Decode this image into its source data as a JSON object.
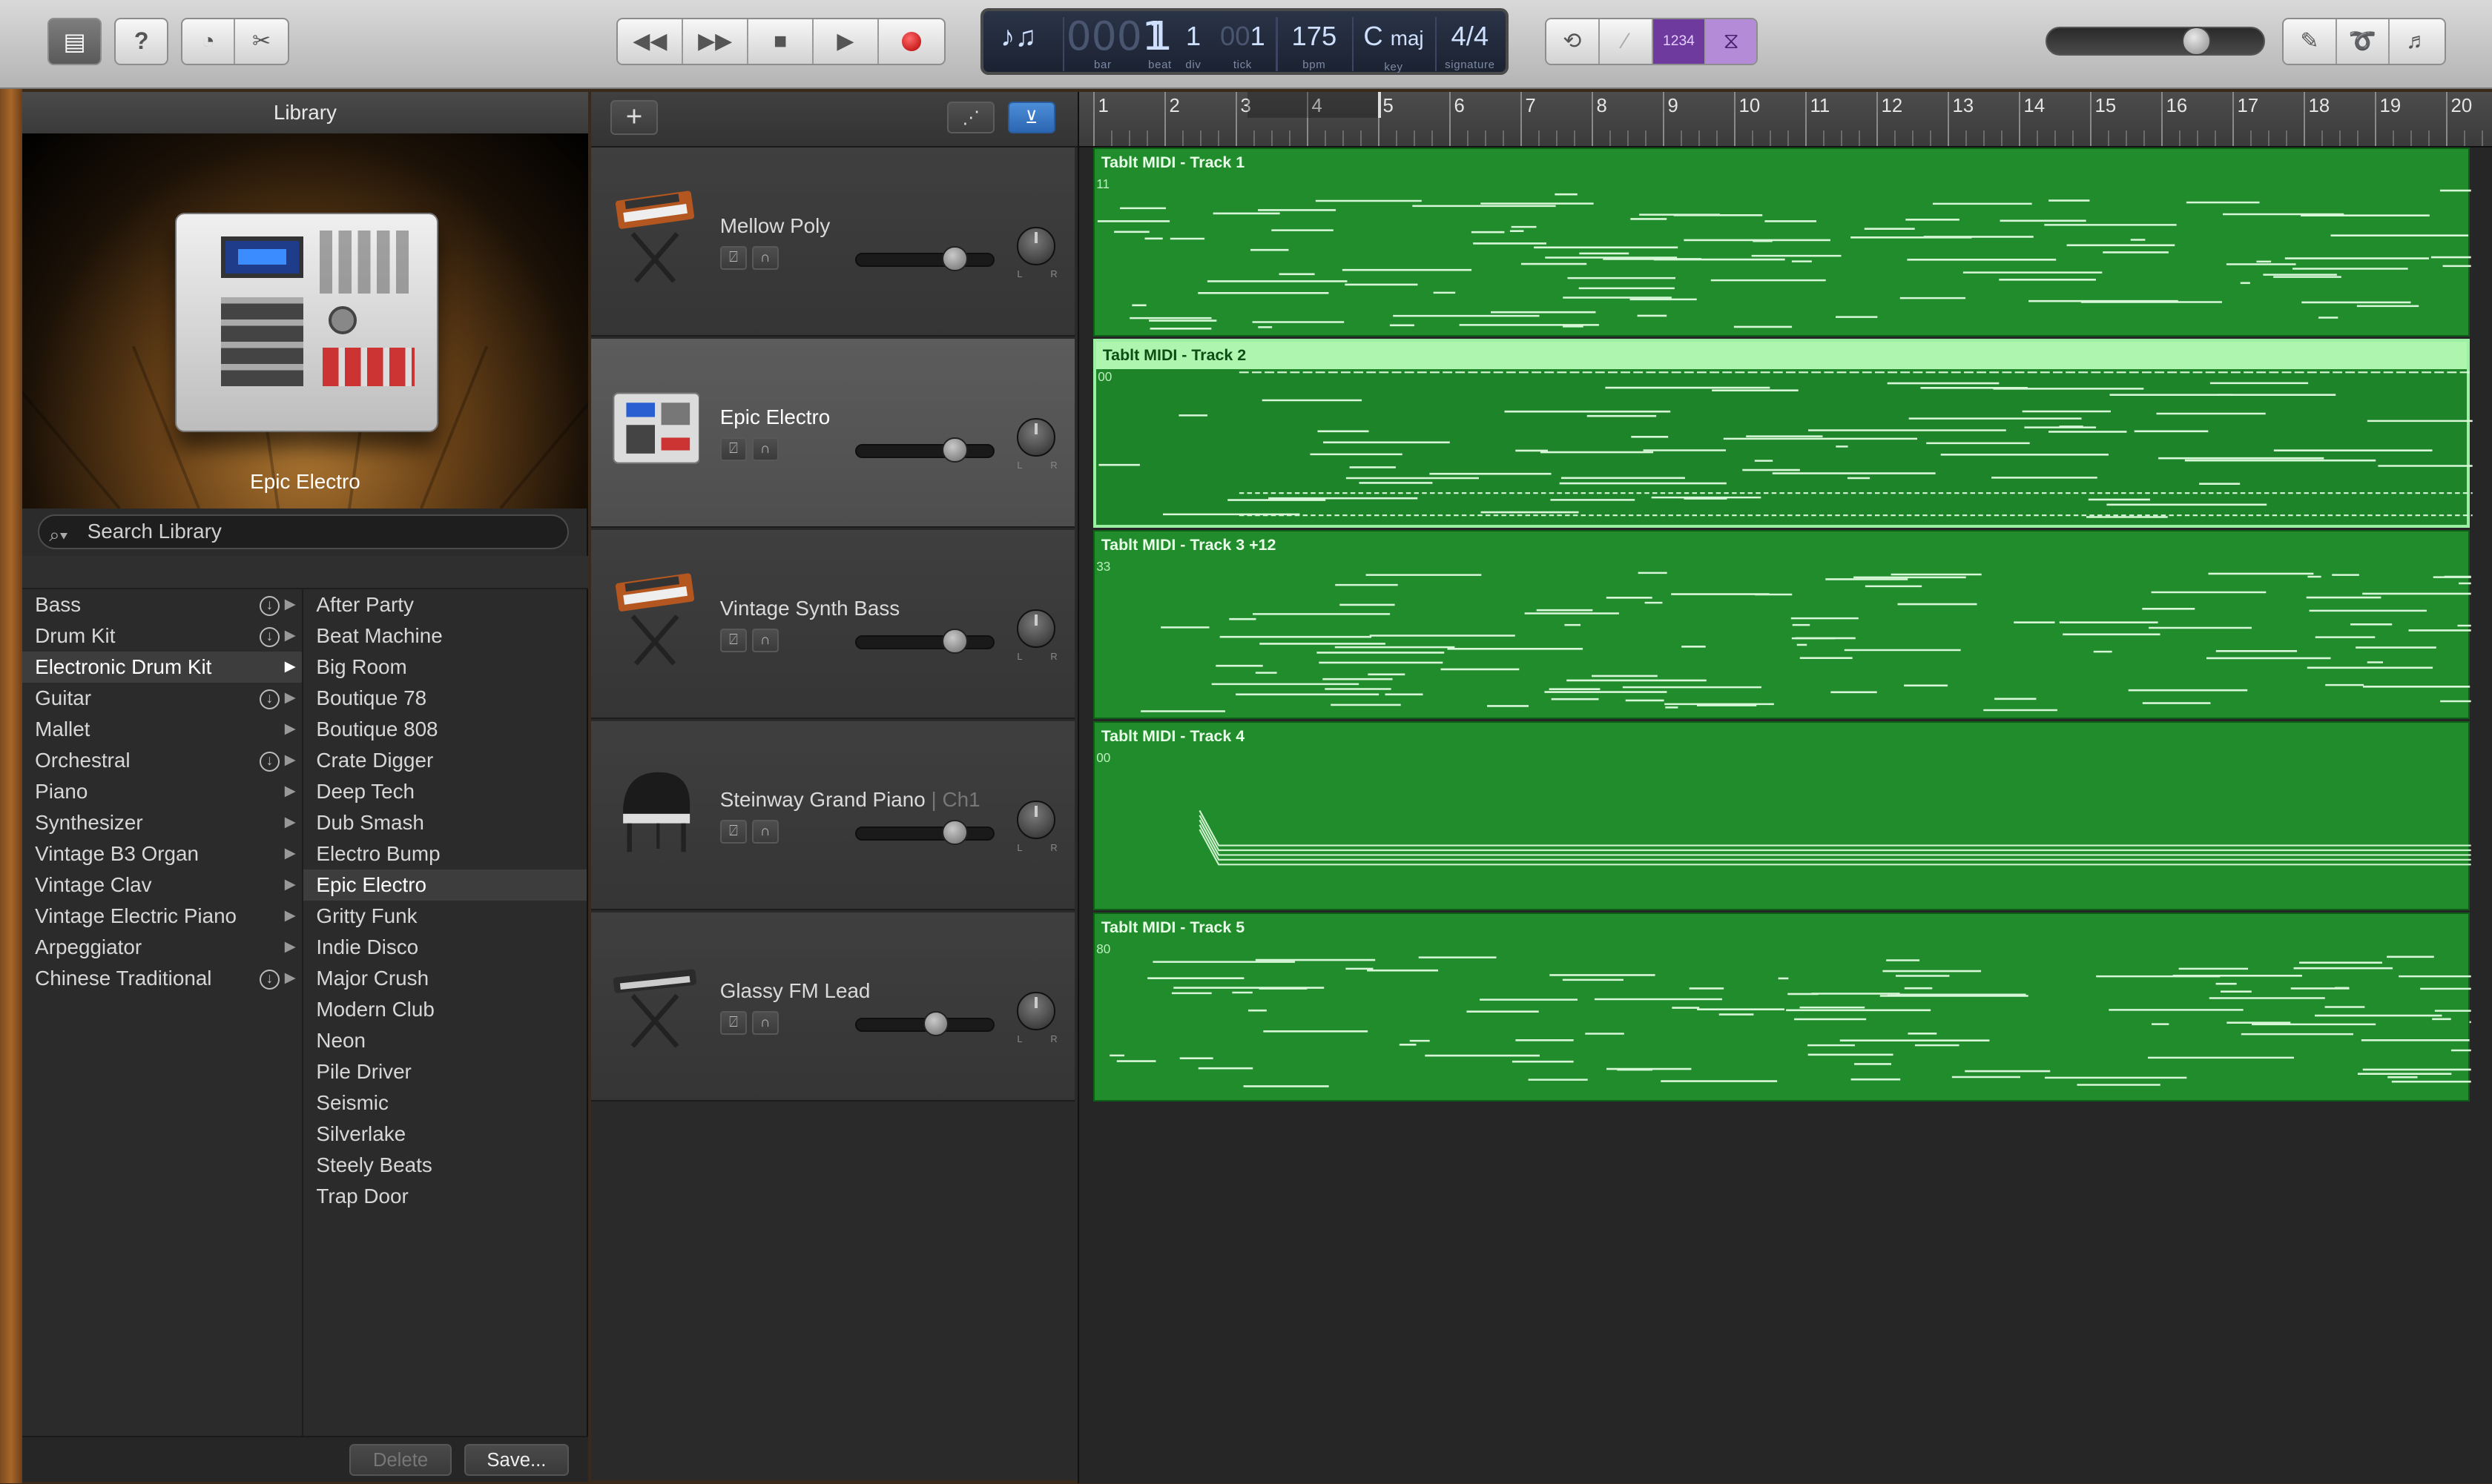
{
  "toolbar": {
    "left_icons": [
      "library-icon",
      "help-icon",
      "smart-controls-icon",
      "editors-icon"
    ],
    "transport": [
      "rewind-icon",
      "fast-forward-icon",
      "stop-icon",
      "play-icon",
      "record-icon"
    ],
    "lcd": {
      "bar": "1",
      "beat": "1",
      "div": "1",
      "tick": "1",
      "bar_prefix": "000",
      "tempo": "175",
      "key": "C",
      "key_mode": "maj",
      "signature": "4/4",
      "labels": {
        "bar": "bar",
        "beat": "beat",
        "div": "div",
        "tick": "tick",
        "bpm": "bpm",
        "key": "key",
        "signature": "signature"
      }
    },
    "count_in_label": "1234",
    "right_icons": [
      "cycle-icon",
      "tuner-icon",
      "count-in-icon",
      "metronome-icon",
      "notepad-icon",
      "loop-browser-icon",
      "media-browser-icon"
    ],
    "master_volume": 0.62,
    "colors": {
      "count_in": "#6e3a9e",
      "metronome": "#b48bd6"
    }
  },
  "library": {
    "title": "Library",
    "preview_label": "Epic Electro",
    "search_placeholder": "Search Library",
    "categories": [
      {
        "label": "Bass",
        "download": true
      },
      {
        "label": "Drum Kit",
        "download": true
      },
      {
        "label": "Electronic Drum Kit",
        "download": false,
        "selected": true
      },
      {
        "label": "Guitar",
        "download": true
      },
      {
        "label": "Mallet",
        "download": false
      },
      {
        "label": "Orchestral",
        "download": true
      },
      {
        "label": "Piano",
        "download": false
      },
      {
        "label": "Synthesizer",
        "download": false
      },
      {
        "label": "Vintage B3 Organ",
        "download": false
      },
      {
        "label": "Vintage Clav",
        "download": false
      },
      {
        "label": "Vintage Electric Piano",
        "download": false
      },
      {
        "label": "Arpeggiator",
        "download": false
      },
      {
        "label": "Chinese Traditional",
        "download": true
      }
    ],
    "patches": [
      "After Party",
      "Beat Machine",
      "Big Room",
      "Boutique 78",
      "Boutique 808",
      "Crate Digger",
      "Deep Tech",
      "Dub Smash",
      "Electro Bump",
      "Epic Electro",
      "Gritty Funk",
      "Indie Disco",
      "Major Crush",
      "Modern Club",
      "Neon",
      "Pile Driver",
      "Seismic",
      "Silverlake",
      "Steely Beats",
      "Trap Door"
    ],
    "selected_patch": "Epic Electro",
    "delete_label": "Delete",
    "save_label": "Save..."
  },
  "tracks_toolbar": {
    "add_label": "+"
  },
  "tracks": [
    {
      "name": "Mellow Poly",
      "sub": "",
      "icon": "synth-keyboard-icon",
      "volume": 0.72,
      "selected": false
    },
    {
      "name": "Epic Electro",
      "sub": "",
      "icon": "drum-machine-icon",
      "volume": 0.72,
      "selected": true
    },
    {
      "name": "Vintage Synth Bass",
      "sub": "",
      "icon": "synth-keyboard-icon",
      "volume": 0.72,
      "selected": false
    },
    {
      "name": "Steinway Grand Piano",
      "sub": "| Ch1",
      "icon": "grand-piano-icon",
      "volume": 0.72,
      "selected": false
    },
    {
      "name": "Glassy FM Lead",
      "sub": "",
      "icon": "keyboard-stand-icon",
      "volume": 0.58,
      "selected": false
    }
  ],
  "ruler": {
    "bars": [
      "1",
      "2",
      "3",
      "4",
      "5",
      "6",
      "7",
      "8",
      "9",
      "10",
      "11",
      "12",
      "13",
      "14",
      "15",
      "16",
      "17",
      "18",
      "19",
      "20"
    ]
  },
  "regions": [
    {
      "title": "Tablt MIDI - Track 1",
      "num": "11",
      "selected": false
    },
    {
      "title": "Tablt MIDI - Track 2",
      "num": "00",
      "selected": true
    },
    {
      "title": "Tablt MIDI - Track 3   +12",
      "num": "33",
      "selected": false
    },
    {
      "title": "Tablt MIDI - Track 4",
      "num": "00",
      "selected": false
    },
    {
      "title": "Tablt MIDI - Track 5",
      "num": "80",
      "selected": false
    }
  ],
  "colors": {
    "region": "#208c2c",
    "region_selected_header": "#aef5b0",
    "note": "#d8f7d8"
  }
}
